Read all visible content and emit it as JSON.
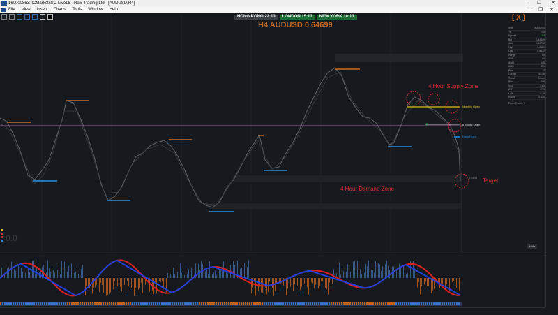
{
  "window": {
    "title": "160000863: ICMarketsSC-Live16 - Raw Trading Ltd - [AUDUSD,H4]",
    "controls": [
      "–",
      "☐",
      "✕"
    ],
    "mdi_controls": [
      "–",
      "❐",
      "✕"
    ]
  },
  "menu": [
    "File",
    "View",
    "Insert",
    "Charts",
    "Tools",
    "Window",
    "Help"
  ],
  "sessions": [
    {
      "name": "HONG KONG",
      "time": "22:13"
    },
    {
      "name": "LONDON",
      "time": "15:13"
    },
    {
      "name": "NEW YORK",
      "time": "10:13"
    }
  ],
  "chart": {
    "symbol_title": "H4 AUDUSD 0.64699",
    "supply_zone_label": "4 Hour Supply Zone",
    "demand_zone_label": "4 Hour Demand Zone",
    "target_label": "Target",
    "monthly_open_label": "Monthly Open",
    "six_month_open_label": "6 Month Open",
    "daily_open_label": "Daily Open",
    "price_marker": "0.6435",
    "colors": {
      "supply": "#e03030",
      "monthly_open": "#e0c020",
      "six_month_open": "#e0e0e0",
      "daily_open": "#2f8fe0",
      "orange_level": "#d06a20",
      "blue_level": "#2f8fe0",
      "magenta_line": "#c080c0"
    }
  },
  "panel": {
    "logo": "[ X ]",
    "rows": [
      {
        "k": "Sym",
        "v": "AUDUSD"
      },
      {
        "k": "TF",
        "v": "H4"
      },
      {
        "k": "Spread",
        "v": "11.4"
      },
      {
        "k": "Bid",
        "v": "0.64699"
      },
      {
        "k": "Ask",
        "v": "0.64710"
      },
      {
        "k": "High",
        "v": "0.6481"
      },
      {
        "k": "Low",
        "v": "0.6432"
      },
      {
        "k": "Range",
        "v": "49"
      },
      {
        "k": "ADR",
        "v": "62"
      },
      {
        "k": "AWR",
        "v": "145"
      },
      {
        "k": "AMR",
        "v": "301"
      },
      {
        "k": "Pips",
        "v": "-12"
      },
      {
        "k": "Candle",
        "v": "03:46"
      },
      {
        "k": "Trend",
        "v": "Down"
      },
      {
        "k": "Bias",
        "v": "Sell"
      },
      {
        "k": "RSI",
        "v": "41.2"
      },
      {
        "k": "ATR",
        "v": "17.9"
      },
      {
        "k": "Lots",
        "v": "0.10"
      },
      {
        "k": "Equity",
        "v": "5,120"
      }
    ],
    "footer": "Open Trades: 0"
  },
  "misc": {
    "hide_button": "Hide",
    "big_counter": "0.0"
  }
}
